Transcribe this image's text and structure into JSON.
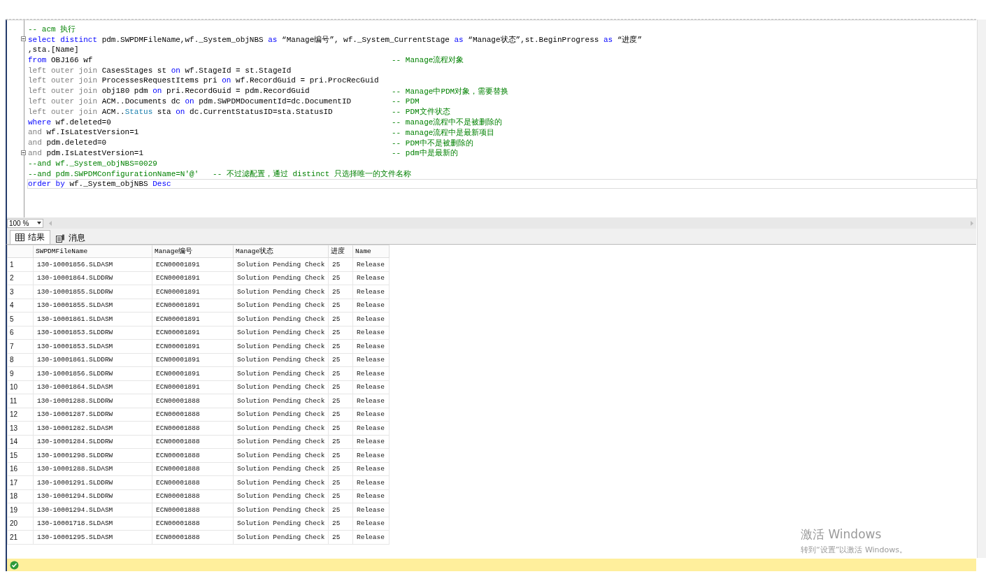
{
  "editor": {
    "lines": [
      {
        "tokens": [
          {
            "kind": "cm",
            "text": "-- acm 执行"
          }
        ],
        "collapsible": false,
        "current": false
      },
      {
        "tokens": [
          {
            "kind": "kw",
            "text": "select distinct "
          },
          {
            "kind": "tx",
            "text": "pdm.SWPDMFileName,wf._System_objNBS "
          },
          {
            "kind": "kw",
            "text": "as "
          },
          {
            "kind": "tx",
            "text": "“Manage编号”, wf._System_CurrentStage "
          },
          {
            "kind": "kw",
            "text": "as "
          },
          {
            "kind": "tx",
            "text": "“Manage状态”,st.BeginProgress "
          },
          {
            "kind": "kw",
            "text": "as "
          },
          {
            "kind": "tx",
            "text": "“进度”"
          }
        ],
        "collapsible": true,
        "current": false
      },
      {
        "tokens": [
          {
            "kind": "tx",
            "text": ",sta.[Name]"
          }
        ],
        "collapsible": false,
        "current": false
      },
      {
        "tokens": [
          {
            "kind": "kw",
            "text": "from "
          },
          {
            "kind": "tx",
            "text": "OBJ166 wf"
          }
        ],
        "comment": "-- Manage流程对象",
        "collapsible": false,
        "current": false
      },
      {
        "tokens": [
          {
            "kind": "op",
            "text": "left outer join "
          },
          {
            "kind": "tx",
            "text": "CasesStages st "
          },
          {
            "kind": "kw",
            "text": "on "
          },
          {
            "kind": "tx",
            "text": "wf.StageId = st.StageId"
          }
        ],
        "collapsible": false,
        "current": false
      },
      {
        "tokens": [
          {
            "kind": "op",
            "text": "left outer join "
          },
          {
            "kind": "tx",
            "text": "ProcessesRequestItems pri "
          },
          {
            "kind": "kw",
            "text": "on "
          },
          {
            "kind": "tx",
            "text": "wf.RecordGuid = pri.ProcRecGuid"
          }
        ],
        "collapsible": false,
        "current": false
      },
      {
        "tokens": [
          {
            "kind": "op",
            "text": "left outer join "
          },
          {
            "kind": "tx",
            "text": "obj180 pdm "
          },
          {
            "kind": "kw",
            "text": "on "
          },
          {
            "kind": "tx",
            "text": "pri.RecordGuid = pdm.RecordGuid"
          }
        ],
        "comment": "-- Manage中PDM对象，需要替换",
        "collapsible": false,
        "current": false
      },
      {
        "tokens": [
          {
            "kind": "op",
            "text": "left outer join "
          },
          {
            "kind": "tx",
            "text": "ACM..Documents dc "
          },
          {
            "kind": "kw",
            "text": "on "
          },
          {
            "kind": "tx",
            "text": "pdm.SWPDMDocumentId=dc.DocumentID"
          }
        ],
        "comment": "-- PDM",
        "collapsible": false,
        "current": false
      },
      {
        "tokens": [
          {
            "kind": "op",
            "text": "left outer join "
          },
          {
            "kind": "tx",
            "text": "ACM.."
          },
          {
            "kind": "fn",
            "text": "Status "
          },
          {
            "kind": "tx",
            "text": "sta "
          },
          {
            "kind": "kw",
            "text": "on "
          },
          {
            "kind": "tx",
            "text": "dc.CurrentStatusID=sta.StatusID"
          }
        ],
        "comment": "-- PDM文件状态",
        "collapsible": false,
        "current": false
      },
      {
        "tokens": [
          {
            "kind": "kw",
            "text": "where "
          },
          {
            "kind": "tx",
            "text": "wf.deleted=0"
          }
        ],
        "comment": "-- manage流程中不是被删除的",
        "collapsible": false,
        "current": false
      },
      {
        "tokens": [
          {
            "kind": "op",
            "text": "and "
          },
          {
            "kind": "tx",
            "text": "wf.IsLatestVersion=1"
          }
        ],
        "comment": "-- manage流程中是最新项目",
        "collapsible": false,
        "current": false
      },
      {
        "tokens": [
          {
            "kind": "op",
            "text": "and "
          },
          {
            "kind": "tx",
            "text": "pdm.deleted=0"
          }
        ],
        "comment": "-- PDM中不是被删除的",
        "collapsible": false,
        "current": false
      },
      {
        "tokens": [
          {
            "kind": "op",
            "text": "and "
          },
          {
            "kind": "tx",
            "text": "pdm.IsLatestVersion=1"
          }
        ],
        "comment": "-- pdm中是最新的",
        "collapsible": true,
        "current": false
      },
      {
        "tokens": [
          {
            "kind": "cm",
            "text": "--and wf._System_objNBS=0029"
          }
        ],
        "collapsible": false,
        "current": false
      },
      {
        "tokens": [
          {
            "kind": "cm",
            "text": "--and pdm.SWPDMConfigurationName=N'@'   -- 不过滤配置，通过 distinct 只选择唯一的文件名称"
          }
        ],
        "collapsible": false,
        "current": false
      },
      {
        "tokens": [
          {
            "kind": "kw",
            "text": "order by "
          },
          {
            "kind": "tx",
            "text": "wf._System_objNBS "
          },
          {
            "kind": "kw",
            "text": "Desc"
          }
        ],
        "collapsible": false,
        "current": true
      }
    ]
  },
  "zoom": {
    "value": "100 %"
  },
  "tabs": [
    {
      "label": "结果",
      "kind": "grid",
      "selected": true
    },
    {
      "label": "消息",
      "kind": "messages",
      "selected": false
    }
  ],
  "grid": {
    "columns": [
      "",
      "SWPDMFileName",
      "Manage编号",
      "Manage状态",
      "进度",
      "Name"
    ],
    "rows": [
      [
        "1",
        "130-10001856.SLDASM",
        "ECN00001891",
        "Solution Pending Check",
        "25",
        "Release"
      ],
      [
        "2",
        "130-10001864.SLDDRW",
        "ECN00001891",
        "Solution Pending Check",
        "25",
        "Release"
      ],
      [
        "3",
        "130-10001855.SLDDRW",
        "ECN00001891",
        "Solution Pending Check",
        "25",
        "Release"
      ],
      [
        "4",
        "130-10001855.SLDASM",
        "ECN00001891",
        "Solution Pending Check",
        "25",
        "Release"
      ],
      [
        "5",
        "130-10001861.SLDASM",
        "ECN00001891",
        "Solution Pending Check",
        "25",
        "Release"
      ],
      [
        "6",
        "130-10001853.SLDDRW",
        "ECN00001891",
        "Solution Pending Check",
        "25",
        "Release"
      ],
      [
        "7",
        "130-10001853.SLDASM",
        "ECN00001891",
        "Solution Pending Check",
        "25",
        "Release"
      ],
      [
        "8",
        "130-10001861.SLDDRW",
        "ECN00001891",
        "Solution Pending Check",
        "25",
        "Release"
      ],
      [
        "9",
        "130-10001856.SLDDRW",
        "ECN00001891",
        "Solution Pending Check",
        "25",
        "Release"
      ],
      [
        "10",
        "130-10001864.SLDASM",
        "ECN00001891",
        "Solution Pending Check",
        "25",
        "Release"
      ],
      [
        "11",
        "130-10001288.SLDDRW",
        "ECN00001888",
        "Solution Pending Check",
        "25",
        "Release"
      ],
      [
        "12",
        "130-10001287.SLDDRW",
        "ECN00001888",
        "Solution Pending Check",
        "25",
        "Release"
      ],
      [
        "13",
        "130-10001282.SLDASM",
        "ECN00001888",
        "Solution Pending Check",
        "25",
        "Release"
      ],
      [
        "14",
        "130-10001284.SLDDRW",
        "ECN00001888",
        "Solution Pending Check",
        "25",
        "Release"
      ],
      [
        "15",
        "130-10001298.SLDDRW",
        "ECN00001888",
        "Solution Pending Check",
        "25",
        "Release"
      ],
      [
        "16",
        "130-10001288.SLDASM",
        "ECN00001888",
        "Solution Pending Check",
        "25",
        "Release"
      ],
      [
        "17",
        "130-10001291.SLDDRW",
        "ECN00001888",
        "Solution Pending Check",
        "25",
        "Release"
      ],
      [
        "18",
        "130-10001294.SLDDRW",
        "ECN00001888",
        "Solution Pending Check",
        "25",
        "Release"
      ],
      [
        "19",
        "130-10001294.SLDASM",
        "ECN00001888",
        "Solution Pending Check",
        "25",
        "Release"
      ],
      [
        "20",
        "130-10001718.SLDASM",
        "ECN00001888",
        "Solution Pending Check",
        "25",
        "Release"
      ],
      [
        "21",
        "130-10001295.SLDASM",
        "ECN00001888",
        "Solution Pending Check",
        "25",
        "Release"
      ]
    ]
  },
  "activation": {
    "title": "激活 Windows",
    "subtitle": "转到“设置”以激活 Windows。"
  },
  "status_bar": {
    "succeeded": true
  }
}
